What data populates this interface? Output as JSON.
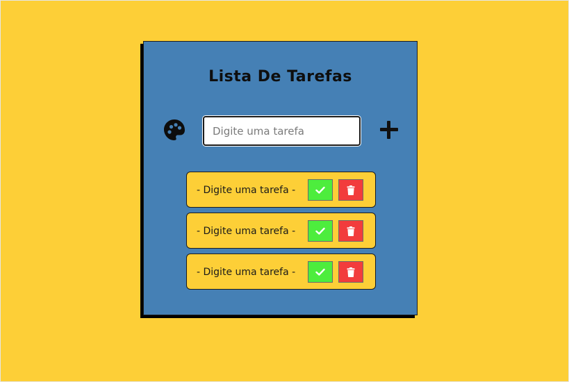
{
  "app": {
    "title": "Lista De Tarefas"
  },
  "colors": {
    "background": "#fdcf37",
    "card": "#4580b5",
    "item": "#fdcf37",
    "check": "#4ded3d",
    "delete": "#f23c3c"
  },
  "input": {
    "placeholder": "Digite uma tarefa",
    "value": ""
  },
  "icons": {
    "palette": "palette-icon",
    "add": "plus-icon",
    "check": "check-icon",
    "delete": "trash-icon"
  },
  "tasks": [
    {
      "text": "- Digite uma tarefa -"
    },
    {
      "text": "- Digite uma tarefa -"
    },
    {
      "text": "- Digite uma tarefa -"
    }
  ]
}
